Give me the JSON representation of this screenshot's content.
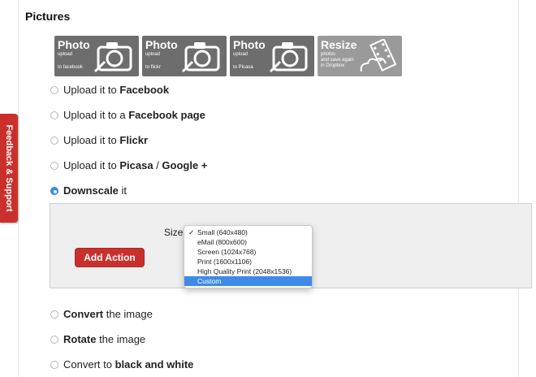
{
  "section": {
    "title": "Pictures"
  },
  "tiles": [
    {
      "big": "Photo",
      "line1": "upload",
      "line2": "to facebook"
    },
    {
      "big": "Photo",
      "line1": "upload",
      "line2": "to flickr"
    },
    {
      "big": "Photo",
      "line1": "upload",
      "line2": "to Picasa"
    },
    {
      "big": "Resize",
      "line1": "photos",
      "line1b": "and save again",
      "line2": "in Dropbox"
    }
  ],
  "feedback": {
    "label": "Feedback & Support"
  },
  "options": {
    "facebook": {
      "pre": "Upload it to ",
      "bold": "Facebook"
    },
    "facebook_page": {
      "pre": "Upload it to a ",
      "bold": "Facebook page"
    },
    "flickr": {
      "pre": "Upload it to ",
      "bold": "Flickr"
    },
    "picasa": {
      "pre": "Upload it to ",
      "bold": "Picasa",
      "mid": " / ",
      "bold2": "Google +"
    },
    "downscale": {
      "bold": "Downscale",
      "post": " it"
    },
    "convert": {
      "bold": "Convert",
      "post": " the image"
    },
    "rotate": {
      "bold": "Rotate",
      "post": " the image"
    },
    "bw": {
      "pre": "Convert to ",
      "bold": "black and white"
    }
  },
  "panel": {
    "size_label": "Size:",
    "add_action": "Add Action",
    "size_options": [
      {
        "label": "Small (640x480)",
        "checked": true
      },
      {
        "label": "eMail (800x600)"
      },
      {
        "label": "Screen (1024x768)"
      },
      {
        "label": "Print (1600x1106)"
      },
      {
        "label": "High Quality Print (2048x1536)"
      },
      {
        "label": "Custom",
        "highlighted": true
      }
    ],
    "checkmark": "✓"
  },
  "colors": {
    "accent_red": "#c9302c",
    "select_blue": "#3f8ae8",
    "tile_dark": "#6d6d6d"
  }
}
